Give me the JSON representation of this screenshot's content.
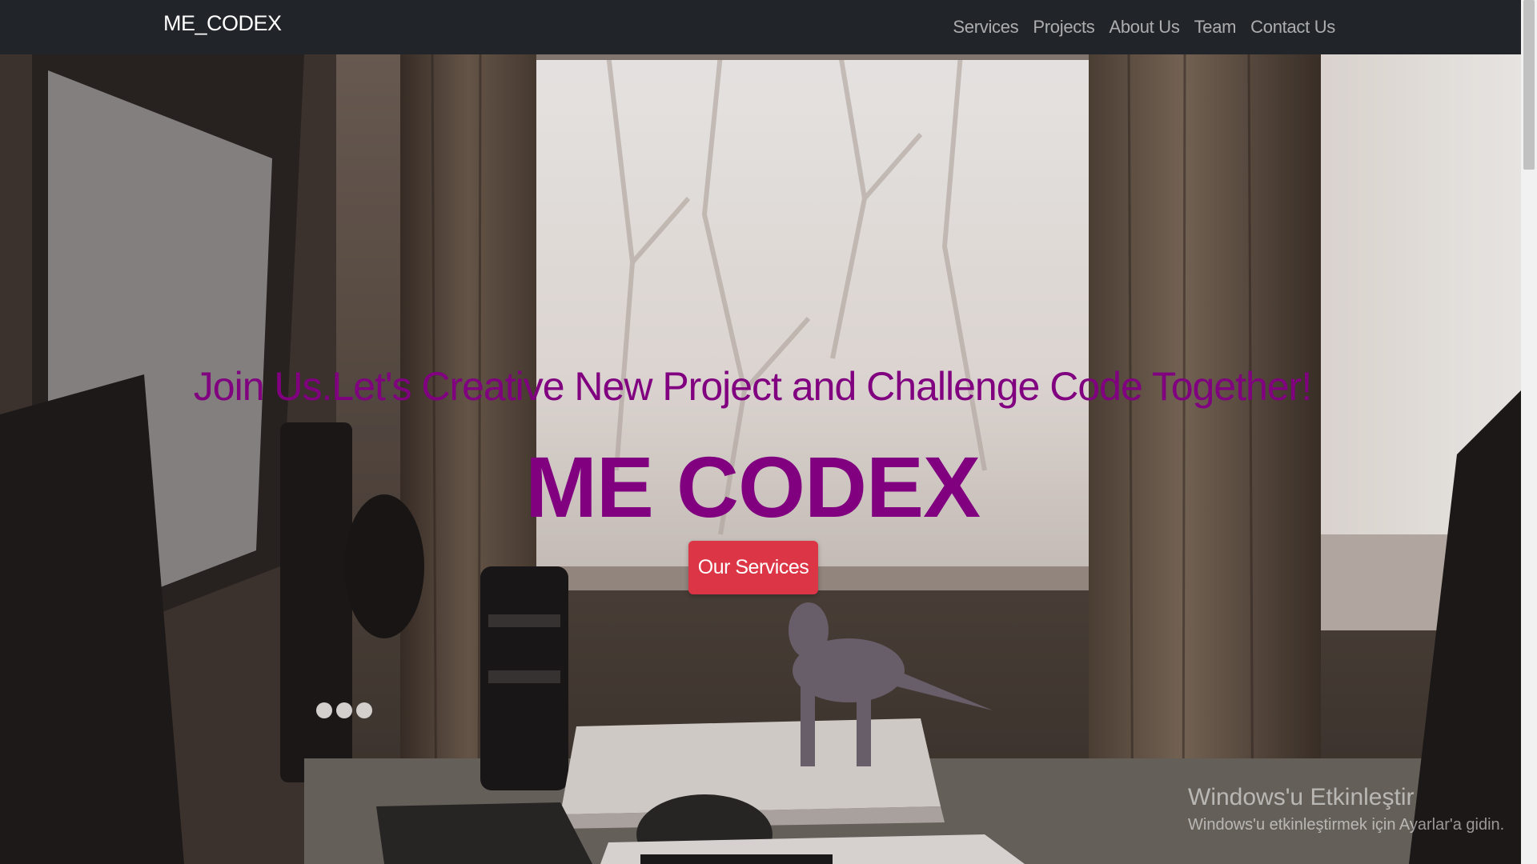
{
  "navbar": {
    "brand": "ME_CODEX",
    "links": [
      "Services",
      "Projects",
      "About Us",
      "Team",
      "Contact Us"
    ]
  },
  "hero": {
    "tagline": "Join Us.Let's Creative New Project and Challenge Code Together!",
    "title": "ME CODEX",
    "cta_label": "Our Services"
  },
  "watermark": {
    "title": "Windows'u Etkinleştir",
    "subtitle": "Windows'u etkinleştirmek için Ayarlar'a gidin."
  },
  "colors": {
    "navbar_bg": "#212529",
    "accent_purple": "#800080",
    "button_red": "#dc3545"
  }
}
